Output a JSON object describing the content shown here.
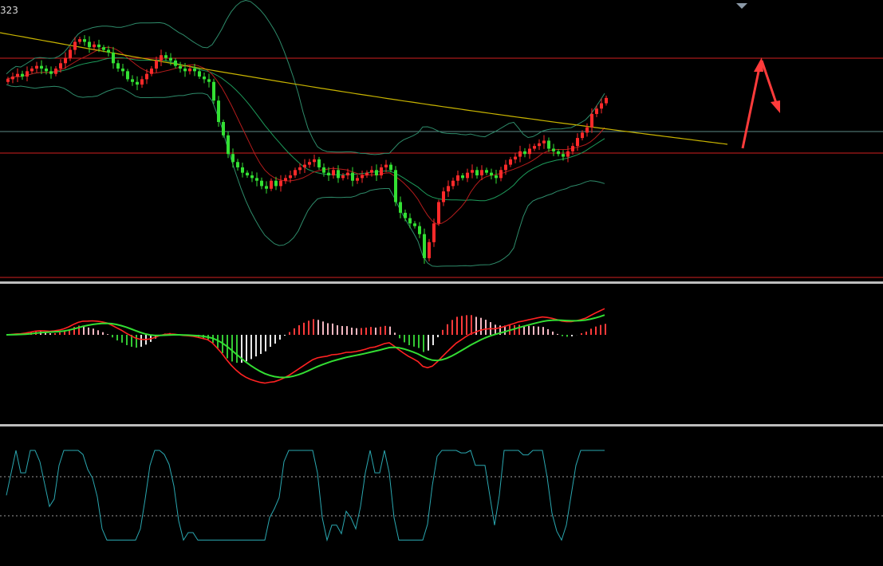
{
  "header": {
    "corner_label": "323"
  },
  "colors": {
    "background": "#000000",
    "bull_candle": "#ff2a2a",
    "bear_candle": "#33e033",
    "level_line": "#d21f1f",
    "reference_line": "#5c8a86",
    "ma_long": "#c8b400",
    "ma_mid": "#1d9a5a",
    "ma_short": "#b51c1c",
    "bollinger": "#2e8b6a",
    "annotation_arrow": "#ff3b3b",
    "panel_separator": "#bdbdbd",
    "macd_signal_red": "#ff2222",
    "macd_line_green": "#33dd33",
    "hist_pos_strong": "#ff3a3a",
    "hist_pos_weak": "#f4b8c2",
    "hist_neg_strong": "#33c833",
    "hist_neg_weak": "#e8e8e8",
    "oscillator": "#2aa7b0",
    "dotted_level": "#9a9a9a"
  },
  "chart_data": [
    {
      "type": "candlestick",
      "name": "price",
      "ylim": [
        0,
        100
      ],
      "levels": [
        {
          "kind": "resistance",
          "value": 92
        },
        {
          "kind": "reference",
          "value": 60
        },
        {
          "kind": "support",
          "value": 50
        },
        {
          "kind": "bottom",
          "value": 2
        }
      ],
      "x": [
        1,
        2,
        3,
        4,
        5,
        6,
        7,
        8,
        9,
        10,
        11,
        12,
        13,
        14,
        15,
        16,
        17,
        18,
        19,
        20,
        21,
        22,
        23,
        24,
        25,
        26,
        27,
        28,
        29,
        30,
        31,
        32,
        33,
        34,
        35,
        36,
        37,
        38,
        39,
        40,
        41,
        42,
        43,
        44,
        45,
        46,
        47,
        48,
        49,
        50,
        51,
        52,
        53,
        54,
        55,
        56,
        57,
        58,
        59,
        60,
        61,
        62,
        63,
        64,
        65,
        66,
        67,
        68,
        69,
        70,
        71,
        72,
        73,
        74,
        75,
        76,
        77,
        78,
        79,
        80,
        81,
        82,
        83,
        84,
        85,
        86,
        87,
        88,
        89,
        90,
        91,
        92,
        93,
        94,
        95,
        96,
        97,
        98,
        99,
        100,
        101,
        102,
        103,
        104,
        105,
        106,
        107,
        108,
        109,
        110,
        111,
        112,
        113,
        114,
        115,
        116,
        117,
        118,
        119,
        120,
        121,
        122,
        123,
        124,
        125,
        126,
        127,
        128,
        129,
        130,
        131,
        132,
        133,
        134,
        135,
        136,
        137,
        138,
        139,
        140,
        141,
        142,
        143,
        144,
        145,
        146,
        147,
        148,
        149,
        150,
        151,
        152,
        153
      ],
      "open": [
        75,
        76,
        77,
        78,
        77,
        79,
        80,
        81,
        80,
        79,
        78,
        80,
        82,
        84,
        87,
        90,
        91,
        90,
        88,
        89,
        88,
        87,
        86,
        82,
        80,
        79,
        76,
        75,
        74,
        76,
        78,
        80,
        83,
        85,
        84,
        83,
        81,
        80,
        79,
        80,
        79,
        77,
        76,
        75,
        68,
        60,
        55,
        48,
        45,
        43,
        41,
        40,
        39,
        38,
        36,
        35,
        38,
        36,
        38,
        39,
        40,
        42,
        43,
        44,
        45,
        46,
        43,
        41,
        40,
        42,
        39,
        40,
        41,
        38,
        39,
        40,
        41,
        42,
        40,
        43,
        44,
        42,
        30,
        26,
        24,
        22,
        21,
        18,
        9,
        15,
        22,
        30,
        34,
        36,
        38,
        40,
        39,
        41,
        42,
        40,
        42,
        41,
        40,
        39,
        42,
        44,
        46,
        47,
        49,
        48,
        50,
        51,
        52,
        53,
        50,
        49,
        48,
        47,
        49,
        51,
        54,
        56,
        58,
        63,
        65,
        67
      ],
      "close": [
        76,
        77,
        78,
        77,
        79,
        80,
        81,
        80,
        79,
        78,
        80,
        82,
        84,
        87,
        90,
        91,
        90,
        88,
        89,
        88,
        87,
        86,
        82,
        80,
        79,
        76,
        75,
        74,
        76,
        78,
        80,
        83,
        85,
        84,
        83,
        81,
        80,
        79,
        80,
        79,
        77,
        76,
        75,
        68,
        60,
        55,
        48,
        45,
        43,
        41,
        40,
        39,
        38,
        36,
        35,
        38,
        36,
        38,
        39,
        40,
        42,
        43,
        44,
        45,
        46,
        43,
        41,
        40,
        42,
        39,
        40,
        41,
        38,
        39,
        40,
        41,
        42,
        40,
        43,
        44,
        42,
        30,
        26,
        24,
        22,
        21,
        18,
        9,
        15,
        22,
        30,
        34,
        36,
        38,
        40,
        39,
        41,
        42,
        40,
        42,
        41,
        40,
        39,
        42,
        44,
        46,
        47,
        49,
        48,
        50,
        51,
        52,
        53,
        50,
        49,
        48,
        47,
        49,
        51,
        54,
        56,
        58,
        63,
        65,
        67,
        69
      ]
    },
    {
      "type": "macd",
      "name": "macd",
      "ylim": [
        -1,
        1
      ],
      "zero": 0
    },
    {
      "type": "line",
      "name": "oscillator",
      "ylim": [
        0,
        100
      ],
      "levels": [
        70,
        30
      ]
    }
  ]
}
